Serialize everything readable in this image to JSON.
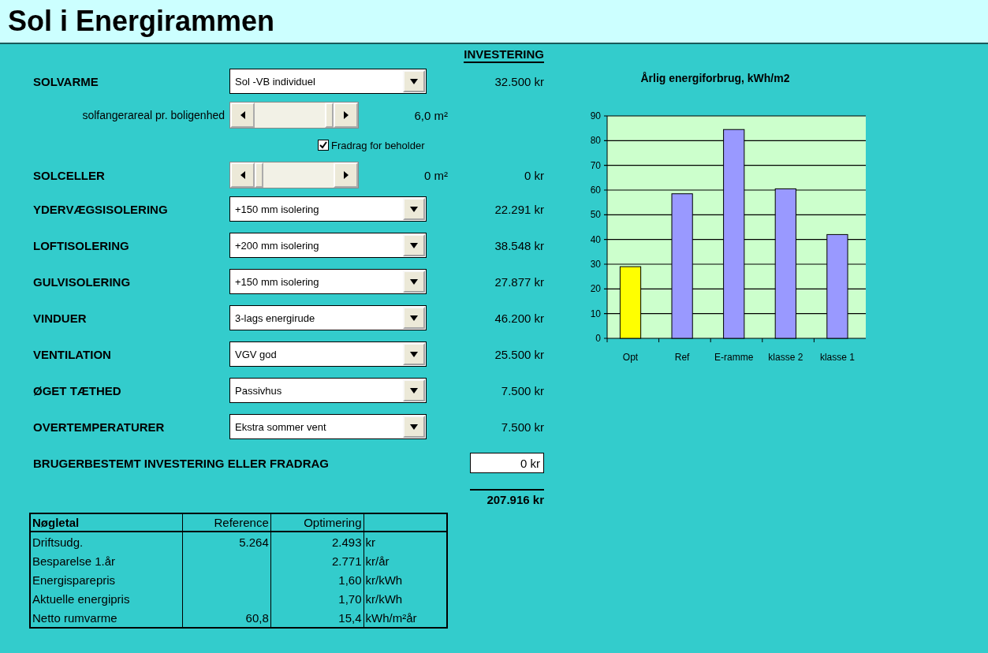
{
  "title": "Sol i Energirammen",
  "investment_header": "INVESTERING",
  "rows": [
    {
      "kind": "dropdown",
      "label": "SOLVARME",
      "value": "Sol -VB individuel",
      "investment": "32.500 kr"
    },
    {
      "kind": "slider",
      "label": "solfangerareal pr. boligenhed",
      "level": 1,
      "reading": "6,0 m²"
    },
    {
      "kind": "checkbox",
      "label": "Fradrag for beholder",
      "checked": true
    },
    {
      "kind": "slider",
      "label": "SOLCELLER",
      "level": 0,
      "reading": "0 m²",
      "investment": "0 kr"
    },
    {
      "kind": "dropdown",
      "label": "YDERVÆGSISOLERING",
      "value": "+150 mm isolering",
      "investment": "22.291 kr"
    },
    {
      "kind": "dropdown",
      "label": "LOFTISOLERING",
      "value": "+200 mm isolering",
      "investment": "38.548 kr"
    },
    {
      "kind": "dropdown",
      "label": "GULVISOLERING",
      "value": "+150 mm isolering",
      "investment": "27.877 kr"
    },
    {
      "kind": "dropdown",
      "label": "VINDUER",
      "value": "3-lags energirude",
      "investment": "46.200 kr"
    },
    {
      "kind": "dropdown",
      "label": "VENTILATION",
      "value": "VGV god",
      "investment": "25.500 kr"
    },
    {
      "kind": "dropdown",
      "label": "ØGET TÆTHED",
      "value": "Passivhus",
      "investment": "7.500 kr"
    },
    {
      "kind": "dropdown",
      "label": "OVERTEMPERATURER",
      "value": "Ekstra sommer vent",
      "investment": "7.500 kr"
    },
    {
      "kind": "input",
      "label": "BRUGERBESTEMT INVESTERING ELLER FRADRAG",
      "value": "0 kr"
    }
  ],
  "total": "207.916 kr",
  "table": {
    "columns": [
      "Nøgletal",
      "Reference",
      "Optimering"
    ],
    "rows": [
      [
        "Driftsudg.",
        "5.264",
        "2.493",
        "kr"
      ],
      [
        "Besparelse 1.år",
        "",
        "2.771",
        "kr/år"
      ],
      [
        "Energisparepris",
        "",
        "1,60",
        "kr/kWh"
      ],
      [
        "Aktuelle energipris",
        "",
        "1,70",
        "kr/kWh"
      ],
      [
        "Netto rumvarme",
        "60,8",
        "15,4",
        "kWh/m²år"
      ]
    ]
  },
  "chart": {
    "chart_data": {
      "type": "bar",
      "title": "Årlig energiforbrug, kWh/m2",
      "categories": [
        "Opt",
        "Ref",
        "E-ramme",
        "klasse 2",
        "klasse 1"
      ],
      "series": [
        {
          "color": "#ffff00",
          "values": [
            29,
            null,
            null,
            null,
            null
          ]
        },
        {
          "color": "#9999ff",
          "values": [
            null,
            58.5,
            84.5,
            60.5,
            42
          ]
        }
      ],
      "stacked": true,
      "grid": true,
      "ylim": [
        0,
        90
      ],
      "yticks": [
        0,
        10,
        20,
        30,
        40,
        50,
        60,
        70,
        80,
        90
      ]
    }
  }
}
